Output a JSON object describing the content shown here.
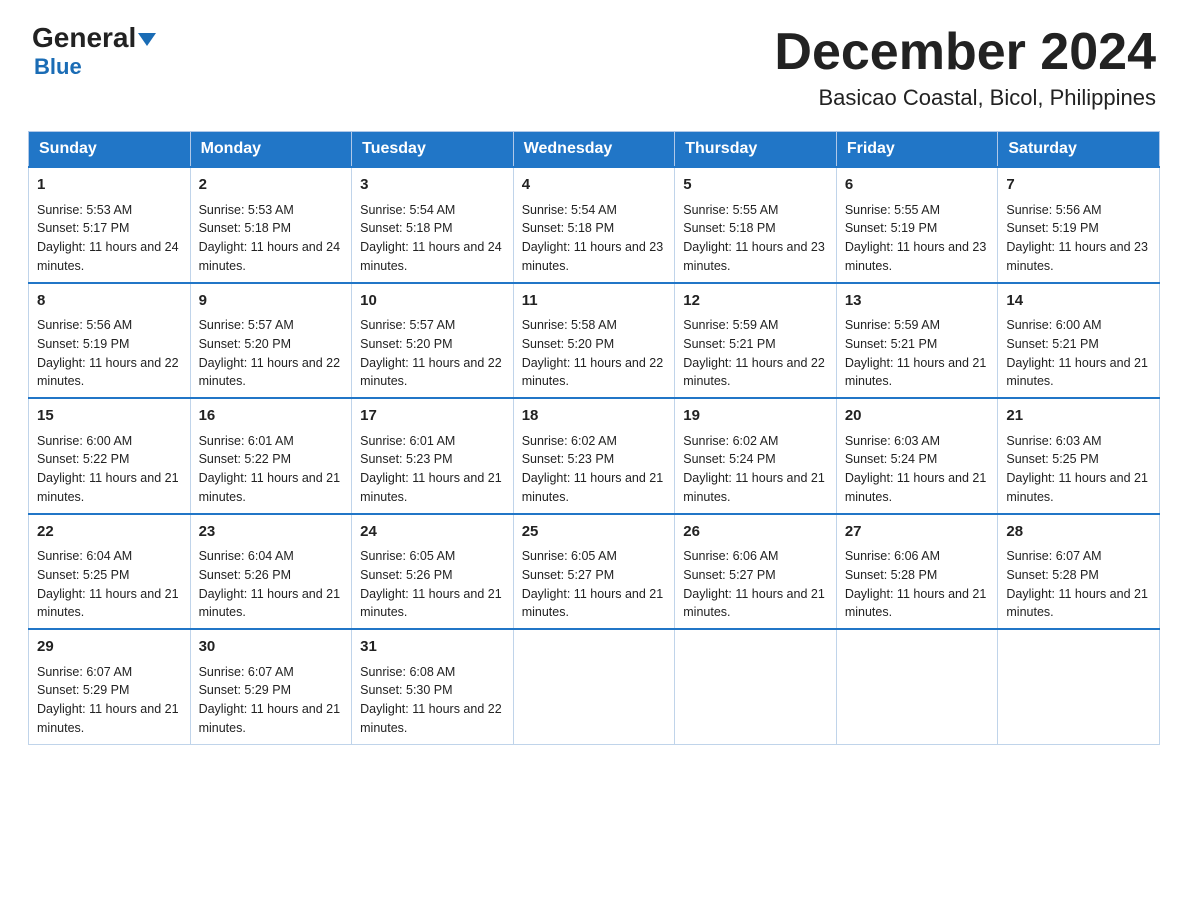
{
  "logo": {
    "general": "General",
    "triangle": "▼",
    "blue": "Blue"
  },
  "title": "December 2024",
  "subtitle": "Basicao Coastal, Bicol, Philippines",
  "days": [
    "Sunday",
    "Monday",
    "Tuesday",
    "Wednesday",
    "Thursday",
    "Friday",
    "Saturday"
  ],
  "weeks": [
    [
      {
        "day": "1",
        "sunrise": "5:53 AM",
        "sunset": "5:17 PM",
        "daylight": "11 hours and 24 minutes."
      },
      {
        "day": "2",
        "sunrise": "5:53 AM",
        "sunset": "5:18 PM",
        "daylight": "11 hours and 24 minutes."
      },
      {
        "day": "3",
        "sunrise": "5:54 AM",
        "sunset": "5:18 PM",
        "daylight": "11 hours and 24 minutes."
      },
      {
        "day": "4",
        "sunrise": "5:54 AM",
        "sunset": "5:18 PM",
        "daylight": "11 hours and 23 minutes."
      },
      {
        "day": "5",
        "sunrise": "5:55 AM",
        "sunset": "5:18 PM",
        "daylight": "11 hours and 23 minutes."
      },
      {
        "day": "6",
        "sunrise": "5:55 AM",
        "sunset": "5:19 PM",
        "daylight": "11 hours and 23 minutes."
      },
      {
        "day": "7",
        "sunrise": "5:56 AM",
        "sunset": "5:19 PM",
        "daylight": "11 hours and 23 minutes."
      }
    ],
    [
      {
        "day": "8",
        "sunrise": "5:56 AM",
        "sunset": "5:19 PM",
        "daylight": "11 hours and 22 minutes."
      },
      {
        "day": "9",
        "sunrise": "5:57 AM",
        "sunset": "5:20 PM",
        "daylight": "11 hours and 22 minutes."
      },
      {
        "day": "10",
        "sunrise": "5:57 AM",
        "sunset": "5:20 PM",
        "daylight": "11 hours and 22 minutes."
      },
      {
        "day": "11",
        "sunrise": "5:58 AM",
        "sunset": "5:20 PM",
        "daylight": "11 hours and 22 minutes."
      },
      {
        "day": "12",
        "sunrise": "5:59 AM",
        "sunset": "5:21 PM",
        "daylight": "11 hours and 22 minutes."
      },
      {
        "day": "13",
        "sunrise": "5:59 AM",
        "sunset": "5:21 PM",
        "daylight": "11 hours and 21 minutes."
      },
      {
        "day": "14",
        "sunrise": "6:00 AM",
        "sunset": "5:21 PM",
        "daylight": "11 hours and 21 minutes."
      }
    ],
    [
      {
        "day": "15",
        "sunrise": "6:00 AM",
        "sunset": "5:22 PM",
        "daylight": "11 hours and 21 minutes."
      },
      {
        "day": "16",
        "sunrise": "6:01 AM",
        "sunset": "5:22 PM",
        "daylight": "11 hours and 21 minutes."
      },
      {
        "day": "17",
        "sunrise": "6:01 AM",
        "sunset": "5:23 PM",
        "daylight": "11 hours and 21 minutes."
      },
      {
        "day": "18",
        "sunrise": "6:02 AM",
        "sunset": "5:23 PM",
        "daylight": "11 hours and 21 minutes."
      },
      {
        "day": "19",
        "sunrise": "6:02 AM",
        "sunset": "5:24 PM",
        "daylight": "11 hours and 21 minutes."
      },
      {
        "day": "20",
        "sunrise": "6:03 AM",
        "sunset": "5:24 PM",
        "daylight": "11 hours and 21 minutes."
      },
      {
        "day": "21",
        "sunrise": "6:03 AM",
        "sunset": "5:25 PM",
        "daylight": "11 hours and 21 minutes."
      }
    ],
    [
      {
        "day": "22",
        "sunrise": "6:04 AM",
        "sunset": "5:25 PM",
        "daylight": "11 hours and 21 minutes."
      },
      {
        "day": "23",
        "sunrise": "6:04 AM",
        "sunset": "5:26 PM",
        "daylight": "11 hours and 21 minutes."
      },
      {
        "day": "24",
        "sunrise": "6:05 AM",
        "sunset": "5:26 PM",
        "daylight": "11 hours and 21 minutes."
      },
      {
        "day": "25",
        "sunrise": "6:05 AM",
        "sunset": "5:27 PM",
        "daylight": "11 hours and 21 minutes."
      },
      {
        "day": "26",
        "sunrise": "6:06 AM",
        "sunset": "5:27 PM",
        "daylight": "11 hours and 21 minutes."
      },
      {
        "day": "27",
        "sunrise": "6:06 AM",
        "sunset": "5:28 PM",
        "daylight": "11 hours and 21 minutes."
      },
      {
        "day": "28",
        "sunrise": "6:07 AM",
        "sunset": "5:28 PM",
        "daylight": "11 hours and 21 minutes."
      }
    ],
    [
      {
        "day": "29",
        "sunrise": "6:07 AM",
        "sunset": "5:29 PM",
        "daylight": "11 hours and 21 minutes."
      },
      {
        "day": "30",
        "sunrise": "6:07 AM",
        "sunset": "5:29 PM",
        "daylight": "11 hours and 21 minutes."
      },
      {
        "day": "31",
        "sunrise": "6:08 AM",
        "sunset": "5:30 PM",
        "daylight": "11 hours and 22 minutes."
      },
      null,
      null,
      null,
      null
    ]
  ]
}
